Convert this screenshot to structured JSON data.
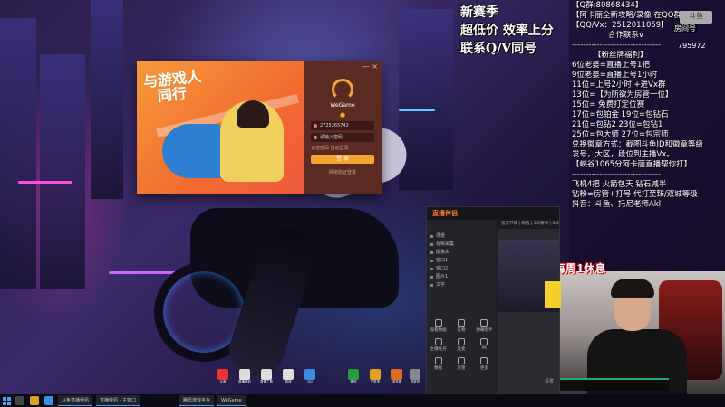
{
  "promo": {
    "line1": "新赛季",
    "line2": "超低价 效率上分",
    "line3": "联系Q/V同号"
  },
  "info_panel": {
    "lines": [
      "【Q群:80868434】",
      "【阿卡丽全新攻略/录像 在QQ群】",
      "【QQ/Vx：2512011059】",
      "合作联系v",
      "--------------------------------",
      "【粉丝牌福利】",
      "6位老婆=直播上号1把",
      "9位老婆=直播上号1小时",
      "11位=上号2小时 +进Vx群",
      "13位=【为所欲为房管一位】",
      "15位= 免费打定位赛",
      "17位=包铂金  19位=包钻石",
      "21位=包钻2  23位=包钻1",
      "25位=包大师  27位=包宗师",
      "兑换徽章方式：截图斗鱼ID和徽章等级",
      "发号，大区，段位到主播Vx。",
      "【峡谷1065分阿卡丽直播帮你打】",
      "--------------------------------",
      "飞机4把 火箭包天 钻石减半",
      "钻粉=房管+打号  代打至臻/双城等级",
      "",
      "抖音：斗鱼、托尼老师Akl"
    ],
    "room_label": "房间号",
    "room_number": "795972",
    "logo_text": "斗鱼"
  },
  "weekly_note": "每周1休息",
  "wegame": {
    "slogan_line1": "与游戏人",
    "slogan_line2": "同行",
    "brand": "WeGame",
    "account": "2725265742",
    "password_placeholder": "请输入密码",
    "remember": "记住密码   自动登录",
    "login_button": "登 录",
    "scan_link": "网络验证登录",
    "close": "— ×"
  },
  "douyu": {
    "title": "直播伴侣",
    "tabs": "官方节目 | 精选 | 5/2赛事 | 3/3赛事 | 精彩回放",
    "side_rows": [
      "场景",
      "视频采集",
      "摄像头",
      "窗口1",
      "窗口2",
      "图片1",
      "文字"
    ],
    "tools": [
      "观看数据",
      "礼物",
      "弹幕助手",
      "主播任务",
      "连麦",
      "PK",
      "数据",
      "房管",
      "更多"
    ],
    "setting": "设置"
  },
  "taskbar": {
    "tasks": [
      "斗鱼直播伴侣",
      "直播伴侣 - 主窗口",
      "腾讯游戏平台",
      "WeGame"
    ]
  },
  "desktop_icons": [
    "斗鱼",
    "直播伴侣",
    "录像工具",
    "游戏",
    "QQ",
    "微信",
    "文件夹",
    "浏览器",
    "回收站"
  ]
}
